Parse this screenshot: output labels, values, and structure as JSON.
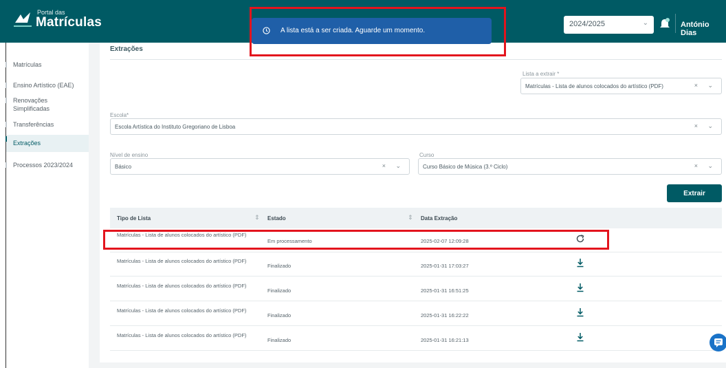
{
  "header": {
    "logo_small": "Portal das",
    "logo_big": "Matrículas",
    "school_year": "2024/2025",
    "user_name": "António Dias"
  },
  "sidebar": {
    "items": [
      {
        "label": "Matrículas"
      },
      {
        "label": "Ensino Artístico (EAE)"
      },
      {
        "label": "Renovações Simplificadas"
      },
      {
        "label": "Transferências"
      },
      {
        "label": "Extrações"
      },
      {
        "label": "Processos 2023/2024"
      }
    ]
  },
  "main": {
    "title": "Extrações",
    "lista": {
      "label": "Lista a extrair *",
      "value": "Matrículas - Lista de alunos colocados do artístico (PDF)"
    },
    "escola": {
      "label": "Escola*",
      "value": "Escola Artística do Instituto Gregoriano de Lisboa"
    },
    "nivel": {
      "label": "Nível de ensino",
      "value": "Básico"
    },
    "curso": {
      "label": "Curso",
      "value": "Curso Básico de Música (3.º Ciclo)"
    },
    "extract_button": "Extrair",
    "table": {
      "headers": [
        "Tipo de Lista",
        "Estado",
        "Data Extração"
      ],
      "rows": [
        {
          "tipo": "Matrículas - Lista de alunos colocados do artístico (PDF)",
          "estado": "Em processamento",
          "data": "2025-02-07 12:09:28",
          "action": "refresh-icon"
        },
        {
          "tipo": "Matrículas - Lista de alunos colocados do artístico (PDF)",
          "estado": "Finalizado",
          "data": "2025-01-31 17:03:27",
          "action": "download-icon"
        },
        {
          "tipo": "Matrículas - Lista de alunos colocados do artístico (PDF)",
          "estado": "Finalizado",
          "data": "2025-01-31 16:51:25",
          "action": "download-icon"
        },
        {
          "tipo": "Matrículas - Lista de alunos colocados do artístico (PDF)",
          "estado": "Finalizado",
          "data": "2025-01-31 16:22:22",
          "action": "download-icon"
        },
        {
          "tipo": "Matrículas - Lista de alunos colocados do artístico (PDF)",
          "estado": "Finalizado",
          "data": "2025-01-31 16:21:13",
          "action": "download-icon"
        }
      ]
    }
  },
  "toast": {
    "message": "A lista está a ser criada. Aguarde um momento."
  },
  "colors": {
    "brand": "#005a64",
    "toast": "#1f5fa8",
    "highlight": "#e3141d"
  }
}
